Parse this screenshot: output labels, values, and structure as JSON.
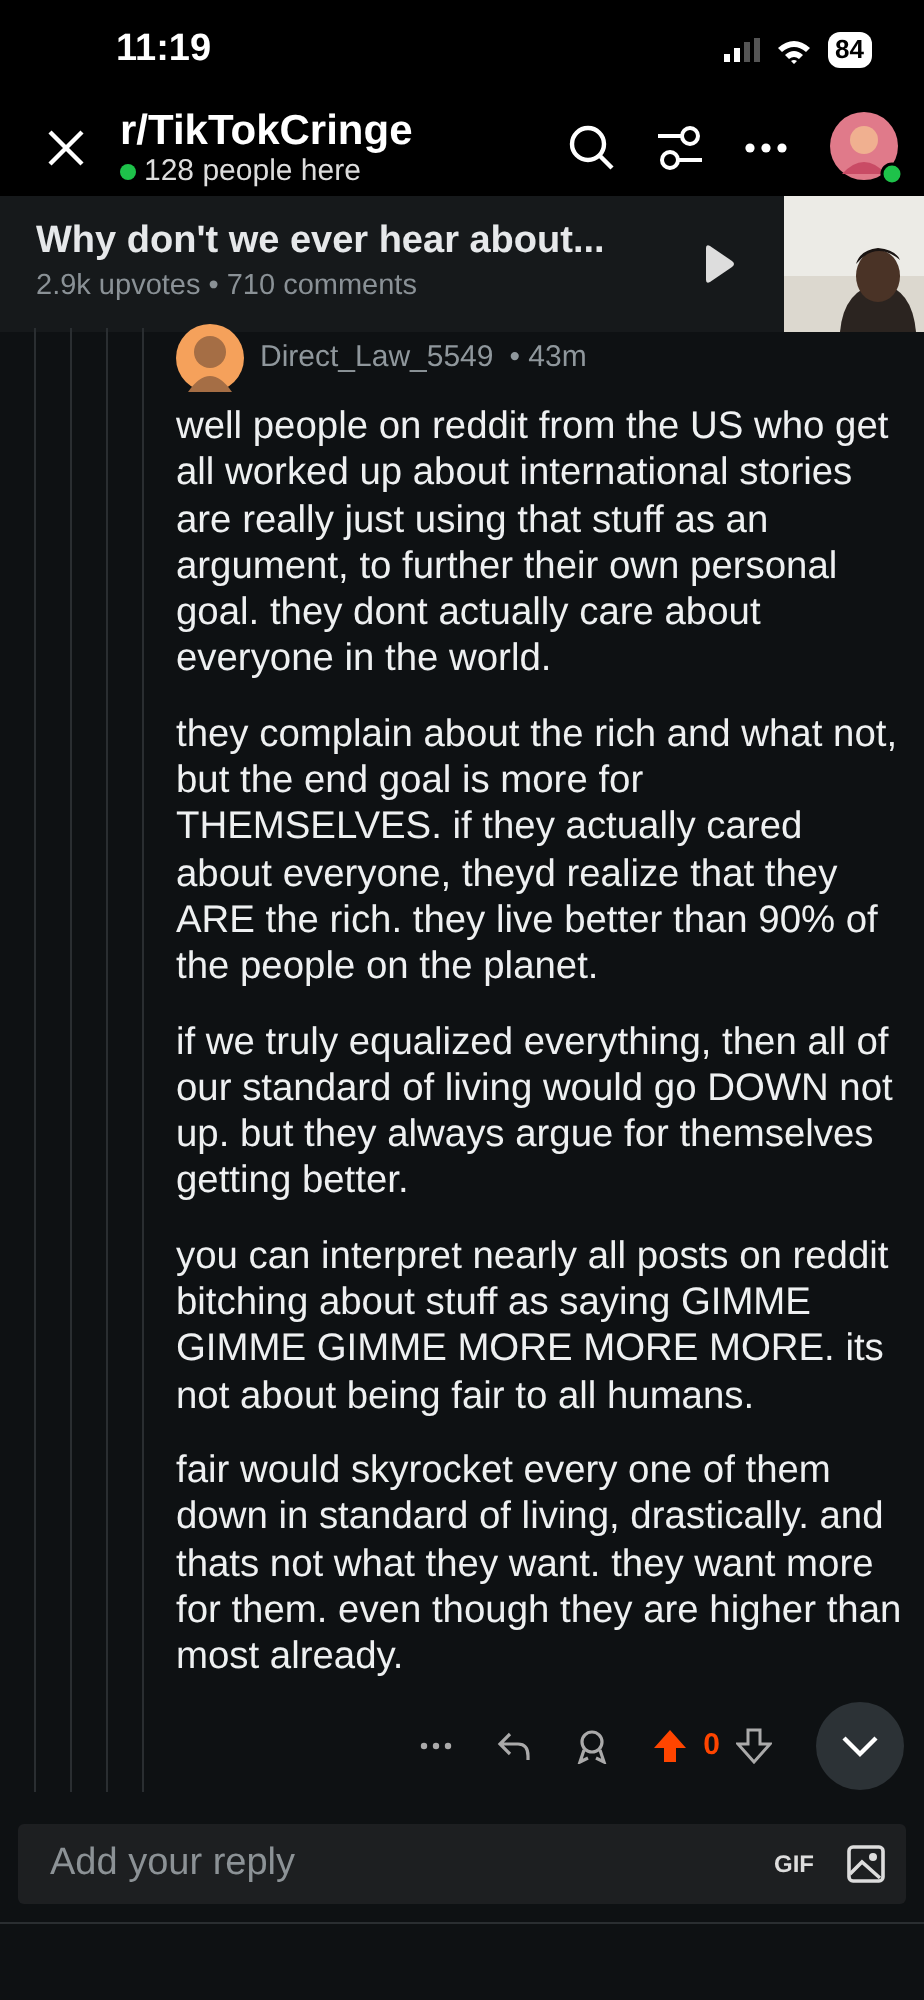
{
  "status_bar": {
    "time": "11:19",
    "battery": "84"
  },
  "header": {
    "subreddit": "r/TikTokCringe",
    "online": "128 people here"
  },
  "post": {
    "title": "Why don't we ever hear about...",
    "meta": "2.9k upvotes • 710 comments"
  },
  "comment": {
    "author": "Direct_Law_5549",
    "age": "• 43m",
    "paragraphs": [
      "well people on reddit from the US who get all worked up about international stories are really just using that stuff as an argument, to further their own personal goal. they dont actually care about everyone in the world.",
      "they complain about the rich and what not, but the end goal is more for THEMSELVES. if they actually cared about everyone, theyd realize that they ARE the rich. they live better than 90% of the people on the planet.",
      "if we truly equalized everything, then all of our standard of living would go DOWN not up. but they always argue for themselves getting better.",
      "you can interpret nearly all posts on reddit bitching about stuff as saying GIMME GIMME GIMME MORE MORE MORE. its not about being fair to all humans.",
      "fair would skyrocket every one of them down in standard of living, drastically. and thats not what they want. they want more for them. even though they are higher than most already."
    ],
    "upvoted": true,
    "score": "0"
  },
  "reply": {
    "placeholder": "Add your reply",
    "gif": "GIF"
  }
}
